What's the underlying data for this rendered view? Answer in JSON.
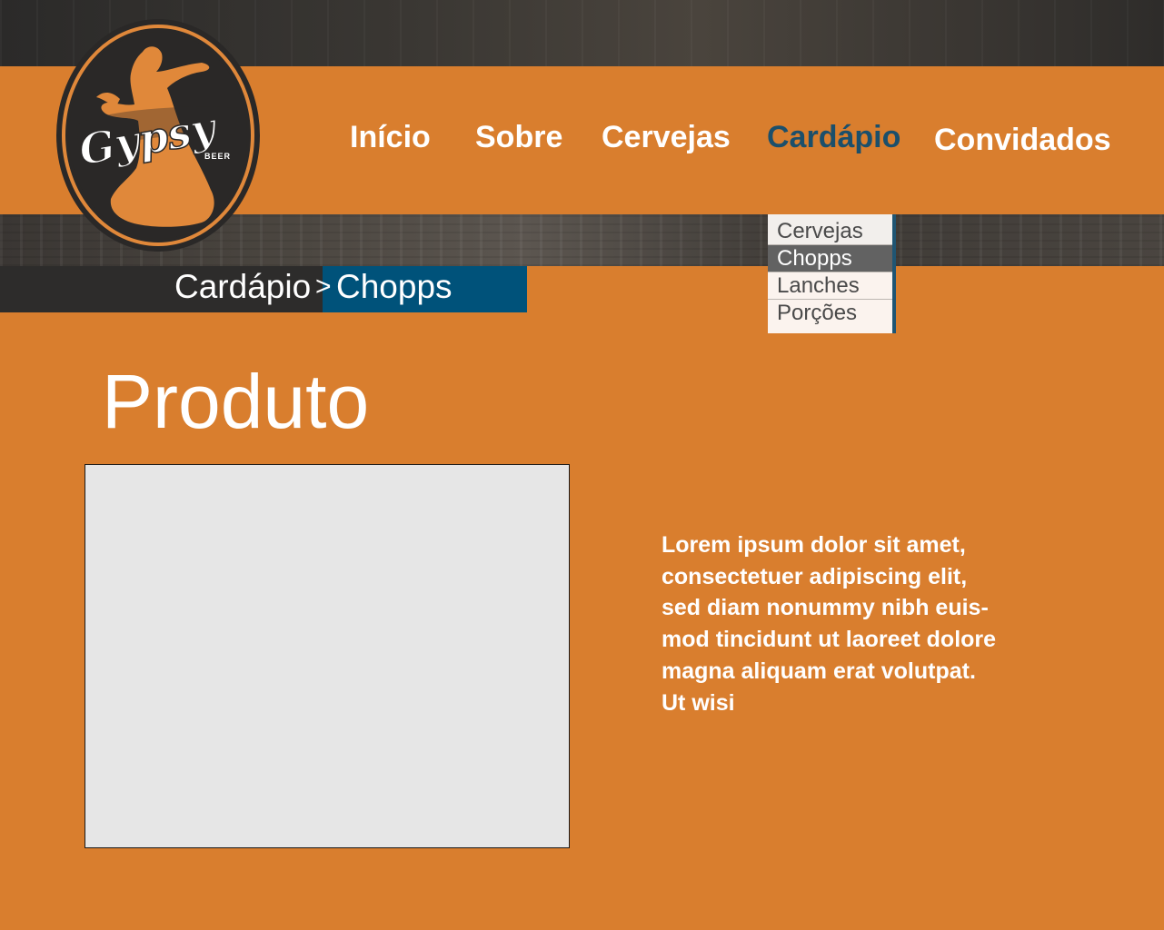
{
  "logo": {
    "brand": "Gypsy",
    "tagline": "BEER"
  },
  "nav": {
    "items": [
      {
        "label": "Início"
      },
      {
        "label": "Sobre"
      },
      {
        "label": "Cervejas"
      },
      {
        "label": "Cardápio",
        "active": true
      },
      {
        "label": "Convidados"
      }
    ]
  },
  "dropdown": {
    "items": [
      {
        "label": "Cervejas"
      },
      {
        "label": "Chopps",
        "selected": true
      },
      {
        "label": "Lanches"
      },
      {
        "label": "Porções"
      }
    ]
  },
  "breadcrumb": {
    "parent": "Cardápio",
    "separator": ">",
    "current": "Chopps"
  },
  "main": {
    "title": "Produto",
    "description_lines": [
      "Lorem ipsum dolor sit amet,",
      "consectetuer adipiscing elit,",
      "sed diam nonummy nibh euis-",
      "mod tincidunt ut laoreet dolore",
      "magna aliquam erat volutpat.",
      "Ut wisi"
    ]
  },
  "colors": {
    "accent_orange": "#d97e2e",
    "accent_blue": "#00527a",
    "active_nav": "#1b4f6b",
    "dark": "#2d2c2b"
  }
}
